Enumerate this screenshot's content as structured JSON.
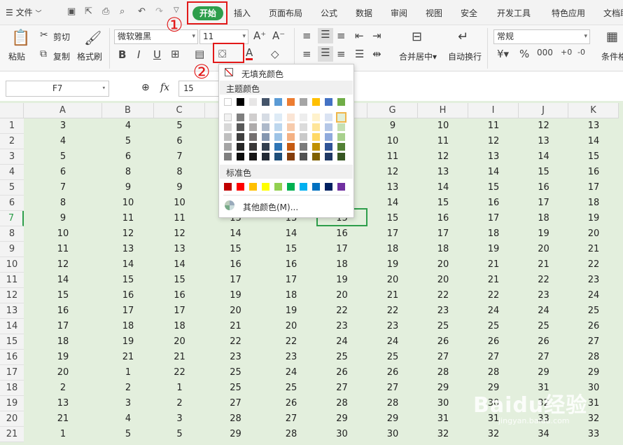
{
  "menu": {
    "file": "文件",
    "tabs": [
      "开始",
      "插入",
      "页面布局",
      "公式",
      "数据",
      "审阅",
      "视图",
      "安全",
      "开发工具",
      "特色应用",
      "文档助"
    ]
  },
  "ribbon": {
    "paste": "粘贴",
    "cut": "剪切",
    "copy": "复制",
    "format_painter": "格式刷",
    "font_name": "微软雅黑",
    "font_size": "11",
    "bold": "B",
    "italic": "I",
    "underline": "U",
    "merge_center": "合并居中",
    "wrap_text": "自动换行",
    "number_format": "常规",
    "currency": "¥",
    "percent": "%",
    "cond_format": "条件格"
  },
  "formula_bar": {
    "cell_ref": "F7",
    "fx": "fx",
    "value": "15"
  },
  "annotations": {
    "step1": "①",
    "step2": "②"
  },
  "colors": {
    "brand": "#2e9e4b",
    "annotation": "#e21919",
    "grid_bg": "#e3efdd"
  },
  "fill_popup": {
    "no_fill": "无填充颜色",
    "theme_title": "主题颜色",
    "theme_top": [
      "#ffffff",
      "#000000",
      "#e7e6e6",
      "#44546a",
      "#5b9bd5",
      "#ed7d31",
      "#a5a5a5",
      "#ffc000",
      "#4472c4",
      "#70ad47"
    ],
    "theme_shades": [
      [
        "#f2f2f2",
        "#7f7f7f",
        "#d0cece",
        "#d6dce4",
        "#deebf6",
        "#fbe5d5",
        "#ededed",
        "#fff2cc",
        "#dae3f3",
        "#e2efd9"
      ],
      [
        "#d8d8d8",
        "#595959",
        "#aeabab",
        "#adb9ca",
        "#bdd7ee",
        "#f7cbac",
        "#dbdbdb",
        "#fee599",
        "#b4c7e7",
        "#c5e0b3"
      ],
      [
        "#bfbfbf",
        "#3f3f3f",
        "#757070",
        "#8496b0",
        "#9dc3e6",
        "#f4b183",
        "#c9c9c9",
        "#ffd965",
        "#8faadc",
        "#a8d08d"
      ],
      [
        "#a5a5a5",
        "#262626",
        "#3a3838",
        "#323f4f",
        "#2e75b5",
        "#c55a11",
        "#7b7b7b",
        "#bf9000",
        "#2f5496",
        "#538135"
      ],
      [
        "#7f7f7f",
        "#0c0c0c",
        "#171616",
        "#222a35",
        "#1e4e79",
        "#833c0b",
        "#525252",
        "#7f6000",
        "#1f3864",
        "#375623"
      ]
    ],
    "standard_title": "标准色",
    "standard": [
      "#c00000",
      "#ff0000",
      "#ffc000",
      "#ffff00",
      "#92d050",
      "#00b050",
      "#00b0f0",
      "#0070c0",
      "#002060",
      "#7030a0"
    ],
    "more": "其他颜色(M)..."
  },
  "columns": [
    "A",
    "B",
    "C",
    "D",
    "E",
    "F",
    "G",
    "H",
    "I",
    "J",
    "K"
  ],
  "rows": [
    [
      "3",
      "4",
      "5",
      "",
      "",
      "",
      "9",
      "10",
      "11",
      "12",
      "13"
    ],
    [
      "4",
      "5",
      "6",
      "",
      "",
      "",
      "10",
      "11",
      "12",
      "13",
      "14"
    ],
    [
      "5",
      "6",
      "7",
      "",
      "",
      "",
      "11",
      "12",
      "13",
      "14",
      "15"
    ],
    [
      "6",
      "8",
      "8",
      "",
      "",
      "",
      "12",
      "13",
      "14",
      "15",
      "16"
    ],
    [
      "7",
      "9",
      "9",
      "",
      "",
      "",
      "13",
      "14",
      "15",
      "16",
      "17"
    ],
    [
      "8",
      "10",
      "10",
      "",
      "",
      "",
      "14",
      "15",
      "16",
      "17",
      "18"
    ],
    [
      "9",
      "11",
      "11",
      "13",
      "13",
      "15",
      "15",
      "16",
      "17",
      "18",
      "19"
    ],
    [
      "10",
      "12",
      "12",
      "14",
      "14",
      "16",
      "17",
      "17",
      "18",
      "19",
      "20"
    ],
    [
      "11",
      "13",
      "13",
      "15",
      "15",
      "17",
      "18",
      "18",
      "19",
      "20",
      "21"
    ],
    [
      "12",
      "14",
      "14",
      "16",
      "16",
      "18",
      "19",
      "20",
      "21",
      "21",
      "22"
    ],
    [
      "14",
      "15",
      "15",
      "17",
      "17",
      "19",
      "20",
      "20",
      "21",
      "22",
      "23"
    ],
    [
      "15",
      "16",
      "16",
      "19",
      "18",
      "20",
      "21",
      "22",
      "22",
      "23",
      "24"
    ],
    [
      "16",
      "17",
      "17",
      "20",
      "19",
      "22",
      "22",
      "23",
      "24",
      "24",
      "25"
    ],
    [
      "17",
      "18",
      "18",
      "21",
      "20",
      "23",
      "23",
      "25",
      "25",
      "25",
      "26"
    ],
    [
      "18",
      "19",
      "20",
      "22",
      "22",
      "24",
      "24",
      "26",
      "26",
      "26",
      "27"
    ],
    [
      "19",
      "21",
      "21",
      "23",
      "23",
      "25",
      "25",
      "27",
      "27",
      "27",
      "28"
    ],
    [
      "20",
      "1",
      "22",
      "25",
      "24",
      "26",
      "26",
      "28",
      "28",
      "29",
      "29"
    ],
    [
      "2",
      "2",
      "1",
      "25",
      "25",
      "27",
      "27",
      "29",
      "29",
      "31",
      "30"
    ],
    [
      "13",
      "3",
      "2",
      "27",
      "26",
      "28",
      "28",
      "30",
      "30",
      "32",
      "31"
    ],
    [
      "21",
      "4",
      "3",
      "28",
      "27",
      "29",
      "29",
      "31",
      "31",
      "33",
      "32"
    ],
    [
      "1",
      "5",
      "5",
      "29",
      "28",
      "30",
      "30",
      "32",
      "32",
      "34",
      "33"
    ]
  ],
  "watermark": {
    "main": "Baidu经验",
    "sub": "jingyan.baidu.com"
  }
}
